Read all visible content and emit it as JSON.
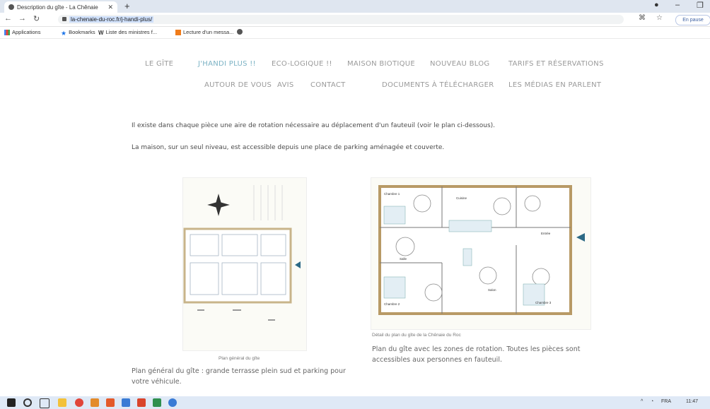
{
  "browser": {
    "tab_title": "Description du gîte - La Chênaie",
    "url": "la-chenaie-du-roc.fr/j-handi-plus/",
    "pause_label": "En pause",
    "bookmarks": [
      {
        "label": "Applications",
        "icon": "apps-grid-icon"
      },
      {
        "label": "Bookmarks",
        "icon": "star-icon"
      },
      {
        "label": "Liste des ministres f...",
        "icon": "wikipedia-icon"
      },
      {
        "label": "Lecture d'un messa...",
        "icon": "mail-icon"
      }
    ]
  },
  "nav": {
    "row1": [
      "LE GÎTE",
      "J'HANDI PLUS !!",
      "ECO-LOGIQUE !!",
      "MAISON BIOTIQUE",
      "NOUVEAU BLOG",
      "TARIFS ET RÉSERVATIONS"
    ],
    "row2": [
      "AUTOUR DE VOUS",
      "AVIS",
      "CONTACT",
      "DOCUMENTS À TÉLÉCHARGER",
      "LES MÉDIAS EN PARLENT"
    ],
    "active": "J'HANDI PLUS !!"
  },
  "content": {
    "para1": "Il existe dans chaque pièce une aire de rotation nécessaire au déplacement d'un fauteuil (voir le plan ci-dessous).",
    "para2": "La maison, sur un seul niveau, est accessible depuis une place de parking aménagée et couverte.",
    "plan_left_caption": "Plan général du gîte",
    "plan_left_desc": "Plan général du gîte :  grande terrasse plein sud et  parking pour votre véhicule.",
    "plan_right_caption": "Détail du plan du gîte de la Chênaie du Roc",
    "plan_right_desc": "Plan du gîte avec les zones de rotation. Toutes les pièces sont accessibles aux personnes en fauteuil.",
    "rooms": [
      "Chambre 1",
      "Cuisine",
      "Entrée",
      "Salle",
      "Salon",
      "Chambre 2",
      "Chambre 3"
    ]
  },
  "taskbar": {
    "lang": "FRA",
    "time": "11:47"
  },
  "colors": {
    "accent": "#7bb2c4",
    "nav_text": "#9a9a9a",
    "body_text": "#4a4a4a"
  }
}
